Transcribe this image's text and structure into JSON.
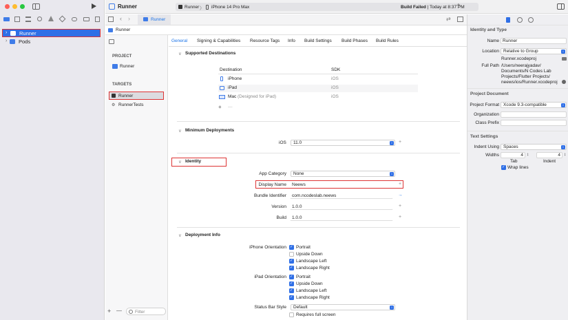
{
  "titlebar": {
    "project": "Runner",
    "scheme": "Runner",
    "destination": "iPhone 14 Pro Max",
    "status_bold": "Build Failed",
    "status_rest": " | Today at 8:37 PM"
  },
  "navigator": {
    "items": [
      {
        "label": "Runner"
      },
      {
        "label": "Pods"
      }
    ],
    "filter_placeholder": "Filter"
  },
  "editor": {
    "tab": "Runner",
    "breadcrumb": "Runner"
  },
  "targets_panel": {
    "project_header": "PROJECT",
    "project_item": "Runner",
    "targets_header": "TARGETS",
    "targets": [
      "Runner",
      "RunnerTests"
    ],
    "filter_placeholder": "Filter"
  },
  "settings_tabs": [
    "General",
    "Signing & Capabilities",
    "Resource Tags",
    "Info",
    "Build Settings",
    "Build Phases",
    "Build Rules"
  ],
  "sections": {
    "supported_destinations": "Supported Destinations",
    "minimum_deployments": "Minimum Deployments",
    "identity": "Identity",
    "deployment_info": "Deployment Info"
  },
  "destinations": {
    "col_destination": "Destination",
    "col_sdk": "SDK",
    "rows": [
      {
        "name": "iPhone",
        "sdk": "iOS"
      },
      {
        "name": "iPad",
        "sdk": "iOS"
      },
      {
        "name": "Mac",
        "extra": "(Designed for iPad)",
        "sdk": "iOS"
      }
    ],
    "add": "+",
    "remove": "—"
  },
  "min_deploy": {
    "label": "iOS",
    "value": "11.0"
  },
  "identity": {
    "app_category_label": "App Category",
    "app_category": "None",
    "display_name_label": "Display Name",
    "display_name": "Neews",
    "bundle_id_label": "Bundle Identifier",
    "bundle_id": "com.ncodeslab.neews",
    "version_label": "Version",
    "version": "1.0.0",
    "build_label": "Build",
    "build": "1.0.0"
  },
  "deployment_info": {
    "iphone_orientation_label": "iPhone Orientation",
    "iphone": [
      {
        "label": "Portrait",
        "checked": true
      },
      {
        "label": "Upside Down",
        "checked": false
      },
      {
        "label": "Landscape Left",
        "checked": true
      },
      {
        "label": "Landscape Right",
        "checked": true
      }
    ],
    "ipad_orientation_label": "iPad Orientation",
    "ipad": [
      {
        "label": "Portrait",
        "checked": true
      },
      {
        "label": "Upside Down",
        "checked": true
      },
      {
        "label": "Landscape Left",
        "checked": true
      },
      {
        "label": "Landscape Right",
        "checked": true
      }
    ],
    "status_bar_label": "Status Bar Style",
    "status_bar": "Default",
    "requires_full_screen": "Requires full screen"
  },
  "inspector": {
    "identity_type": "Identity and Type",
    "name_label": "Name",
    "name": "Runner",
    "location_label": "Location",
    "location": "Relative to Group",
    "filename": "Runner.xcodeproj",
    "full_path_label": "Full Path",
    "full_path": [
      "/Users/neerajyadav/",
      "Documents/N Codes Lab",
      "Projects/Flutter Projects/",
      "neews/ios/Runner.xcodeproj"
    ],
    "project_document": "Project Document",
    "project_format_label": "Project Format",
    "project_format": "Xcode 9.3-compatible",
    "organization_label": "Organization",
    "class_prefix_label": "Class Prefix",
    "text_settings": "Text Settings",
    "indent_using_label": "Indent Using",
    "indent_using": "Spaces",
    "widths_label": "Widths",
    "tab_width": "4",
    "indent_width": "4",
    "tab_caption": "Tab",
    "indent_caption": "Indent",
    "wrap_lines": "Wrap lines"
  }
}
